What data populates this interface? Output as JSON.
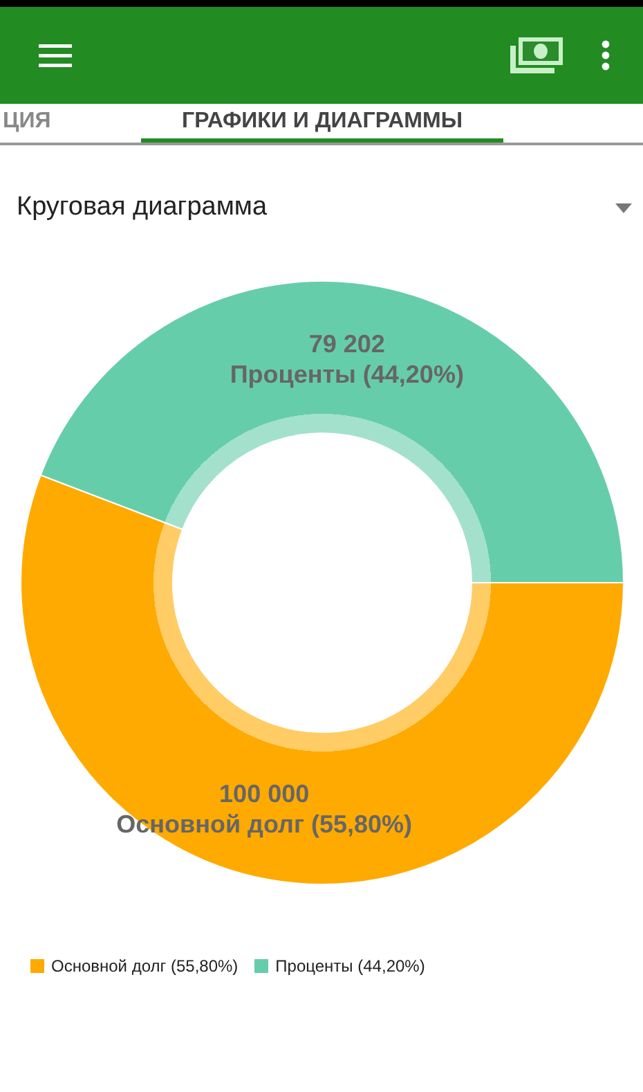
{
  "tabs": [
    {
      "label": "ЦИЯ",
      "selected": false
    },
    {
      "label": "ГРАФИКИ И ДИАГРАММЫ",
      "selected": true
    }
  ],
  "chart_type_select": {
    "value": "Круговая диаграмма"
  },
  "chart": {
    "chart_data": {
      "type": "donut",
      "categories": [
        "Основной долг (55,80%)",
        "Проценты (44,20%)"
      ],
      "values": [
        100000,
        79202
      ],
      "value_labels": [
        "100 000",
        "79 202"
      ],
      "data_labels": true
    },
    "legend": [
      {
        "label": "Основной долг (55,80%)",
        "color": "#ffaa00"
      },
      {
        "label": "Проценты (44,20%)",
        "color": "#66cdaa"
      }
    ]
  }
}
